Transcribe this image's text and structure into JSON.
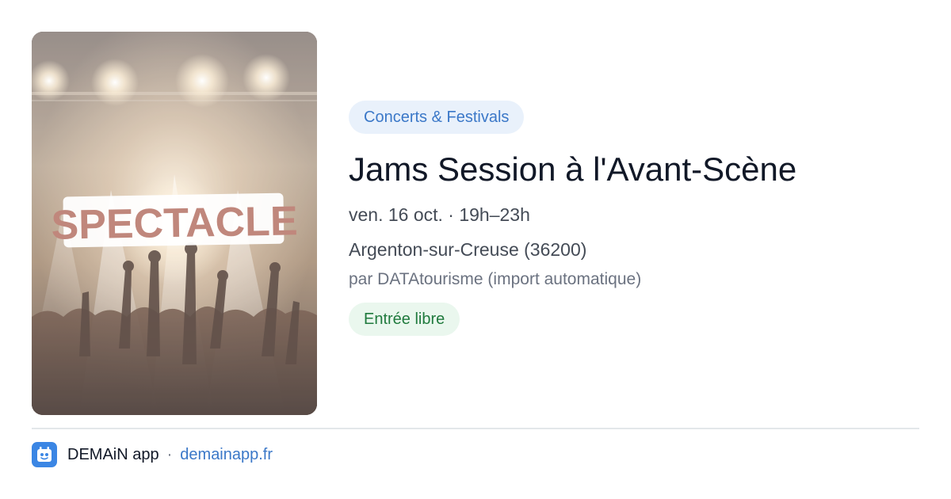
{
  "poster": {
    "label": "SPECTACLE",
    "icon": "concert-crowd-image"
  },
  "event": {
    "category": "Concerts & Festivals",
    "title": "Jams Session à l'Avant-Scène",
    "date_time": "ven. 16 oct. · 19h–23h",
    "location": "Argenton-sur-Creuse (36200)",
    "author": "par DATAtourisme (import automatique)",
    "price": "Entrée libre"
  },
  "footer": {
    "app_name": "DEMAiN app",
    "separator": "·",
    "app_url": "demainapp.fr",
    "app_icon": "demain-logo-icon"
  },
  "colors": {
    "category_bg": "#e9f1fb",
    "category_text": "#3b78c8",
    "price_bg": "#eaf7ee",
    "price_text": "#1f7a3d",
    "link": "#3b78c8",
    "title": "#111827"
  }
}
